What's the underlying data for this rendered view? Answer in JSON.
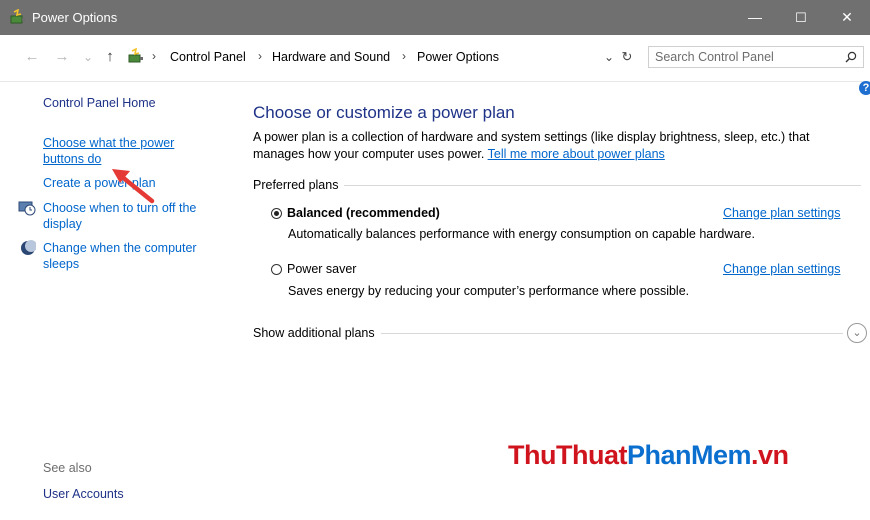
{
  "window": {
    "title": "Power Options",
    "controls": {
      "minimize": "—",
      "maximize": "☐",
      "close": "✕"
    }
  },
  "address_bar": {
    "back": "←",
    "forward": "→",
    "recent": "⌄",
    "up": "↑",
    "breadcrumb": [
      "Control Panel",
      "Hardware and Sound",
      "Power Options"
    ],
    "separator": "›",
    "dropdown": "⌄",
    "refresh": "↻",
    "search_placeholder": "Search Control Panel"
  },
  "sidebar": {
    "home": "Control Panel Home",
    "links": [
      {
        "label": "Choose what the power buttons do",
        "icon": ""
      },
      {
        "label": "Create a power plan",
        "icon": ""
      },
      {
        "label": "Choose when to turn off the display",
        "icon": "display-icon"
      },
      {
        "label": "Change when the computer sleeps",
        "icon": "moon-icon"
      }
    ],
    "see_also": "See also",
    "user_accounts": "User Accounts"
  },
  "main": {
    "title": "Choose or customize a power plan",
    "description": "A power plan is a collection of hardware and system settings (like display brightness, sleep, etc.) that manages how your computer uses power.",
    "learn_more": "Tell me more about power plans",
    "preferred_label": "Preferred plans",
    "plans": [
      {
        "name": "Balanced (recommended)",
        "selected": true,
        "description": "Automatically balances performance with energy consumption on capable hardware.",
        "link": "Change plan settings"
      },
      {
        "name": "Power saver",
        "selected": false,
        "description": "Saves energy by reducing your computer’s performance where possible.",
        "link": "Change plan settings"
      }
    ],
    "additional_label": "Show additional plans",
    "expander": "⌄"
  },
  "watermark": {
    "part1": "ThuThuat",
    "part2": "PhanMem",
    "part3": ".vn"
  },
  "colors": {
    "title_bar": "#707070",
    "link": "#0066cc",
    "heading": "#1e3287",
    "arrow": "#e53935"
  }
}
